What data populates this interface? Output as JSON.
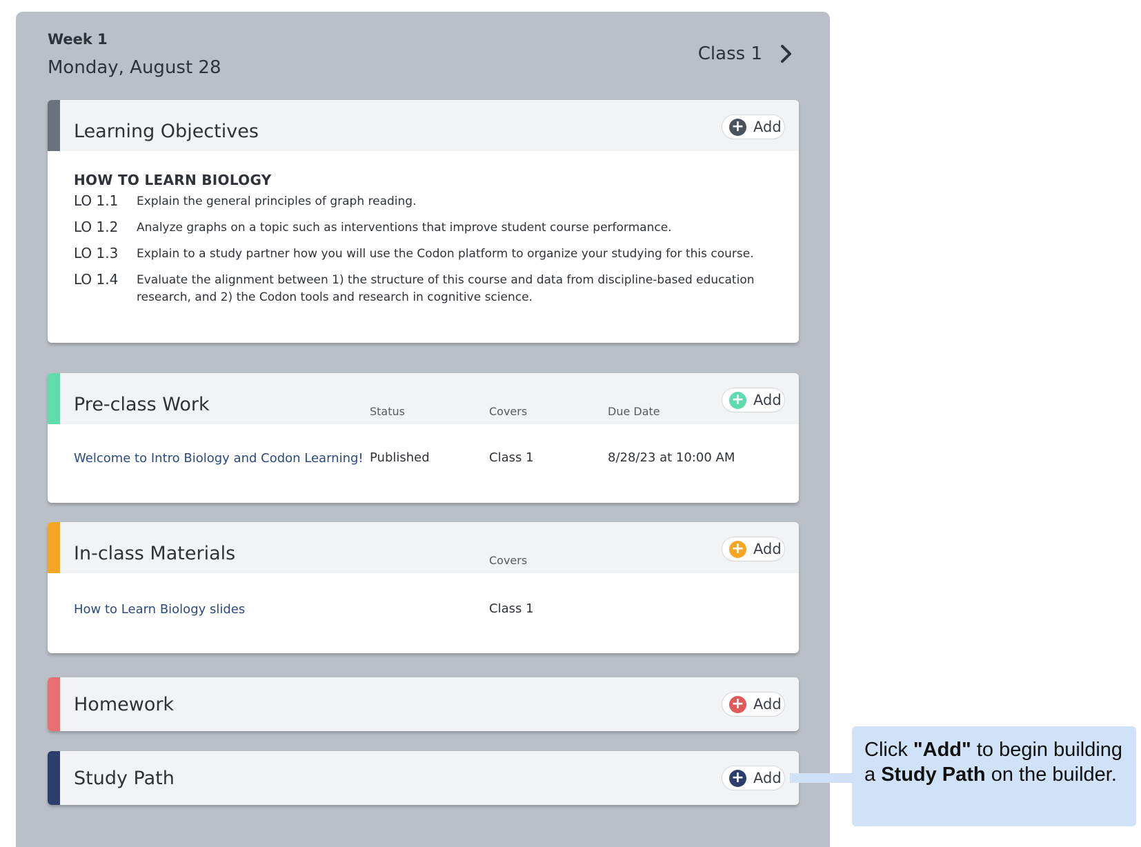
{
  "header": {
    "week": "Week 1",
    "date": "Monday, August 28",
    "class_nav": "Class 1"
  },
  "learning_objectives": {
    "title": "Learning Objectives",
    "add_label": "Add",
    "section_title": "HOW TO LEARN BIOLOGY",
    "items": [
      {
        "code": "LO 1.1",
        "text": "Explain the general principles of graph reading."
      },
      {
        "code": "LO 1.2",
        "text": "Analyze graphs on a topic such as interventions that improve student course performance."
      },
      {
        "code": "LO 1.3",
        "text": "Explain to a study partner how you will use the Codon platform to organize your studying for this course."
      },
      {
        "code": "LO 1.4",
        "text": "Evaluate the alignment between 1) the structure of this course and data from discipline-based education research, and 2) the Codon tools and research in cognitive science."
      }
    ]
  },
  "preclass": {
    "title": "Pre-class Work",
    "add_label": "Add",
    "columns": {
      "status": "Status",
      "covers": "Covers",
      "due": "Due Date"
    },
    "row": {
      "name": "Welcome to Intro Biology and Codon Learning!",
      "status": "Published",
      "covers": "Class 1",
      "due": "8/28/23 at 10:00 AM"
    }
  },
  "inclass": {
    "title": "In-class Materials",
    "add_label": "Add",
    "columns": {
      "covers": "Covers"
    },
    "row": {
      "name": "How to Learn Biology slides",
      "covers": "Class 1"
    }
  },
  "homework": {
    "title": "Homework",
    "add_label": "Add"
  },
  "study_path": {
    "title": "Study Path",
    "add_label": "Add"
  },
  "callout": {
    "t1": "Click ",
    "b1": "\"Add\"",
    "t2": " to begin building a ",
    "b2": "Study Path",
    "t3": " on the builder."
  },
  "colors": {
    "lo_accent": "#6a737d",
    "preclass_accent": "#5fdcae",
    "inclass_accent": "#f5a623",
    "homework_accent": "#e87070",
    "studypath_accent": "#2c3e6b",
    "panel_bg": "#bbc0c8",
    "callout_bg": "#cfe2f8"
  },
  "icons": {
    "next": "chevron-right-icon",
    "add": "plus-circle-icon"
  }
}
